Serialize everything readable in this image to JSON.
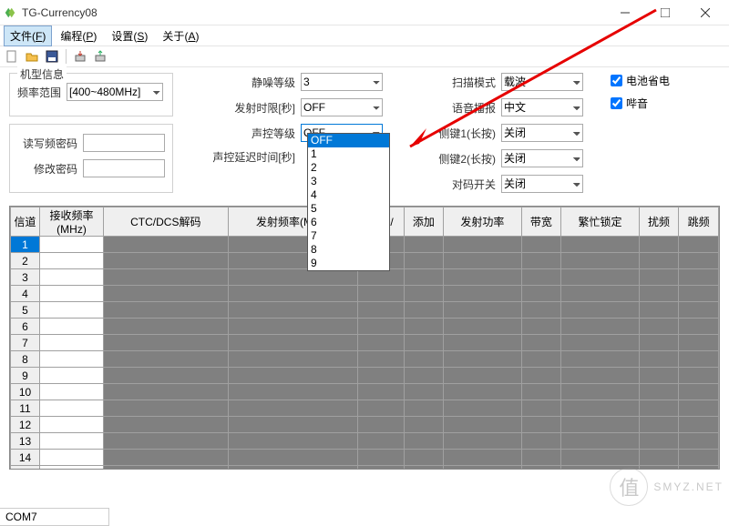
{
  "window": {
    "title": "TG-Currency08"
  },
  "menu": {
    "file": "文件",
    "file_m": "F",
    "prog": "编程",
    "prog_m": "P",
    "set": "设置",
    "set_m": "S",
    "about": "关于",
    "about_m": "A"
  },
  "group": {
    "model_info": "机型信息",
    "freq_range_lbl": "频率范围",
    "freq_range_val": "[400~480MHz]",
    "rw_pwd_lbl": "读写频密码",
    "mod_pwd_lbl": "修改密码"
  },
  "mid": {
    "squelch_lbl": "静噪等级",
    "squelch_val": "3",
    "tot_lbl": "发射时限[秒]",
    "tot_val": "OFF",
    "vox_lbl": "声控等级",
    "vox_val": "OFF",
    "voxdelay_lbl": "声控延迟时间[秒]"
  },
  "r1": {
    "scan_lbl": "扫描模式",
    "scan_val": "载波",
    "voice_lbl": "语音播报",
    "voice_val": "中文",
    "sk1_lbl": "侧键1(长按)",
    "sk1_val": "关闭",
    "sk2_lbl": "侧键2(长按)",
    "sk2_val": "关闭",
    "code_lbl": "对码开关",
    "code_val": "关闭"
  },
  "r2": {
    "batsave": "电池省电",
    "beep": "哔音"
  },
  "dropdown": {
    "options": [
      "OFF",
      "1",
      "2",
      "3",
      "4",
      "5",
      "6",
      "7",
      "8",
      "9"
    ]
  },
  "cols": [
    "信道",
    "接收频率(MHz)",
    "CTC/DCS解码",
    "发射频率(MHz)",
    "CTC/",
    "添加",
    "发射功率",
    "带宽",
    "繁忙锁定",
    "扰频",
    "跳频"
  ],
  "status": "COM7",
  "wm": "SMYZ.NET"
}
